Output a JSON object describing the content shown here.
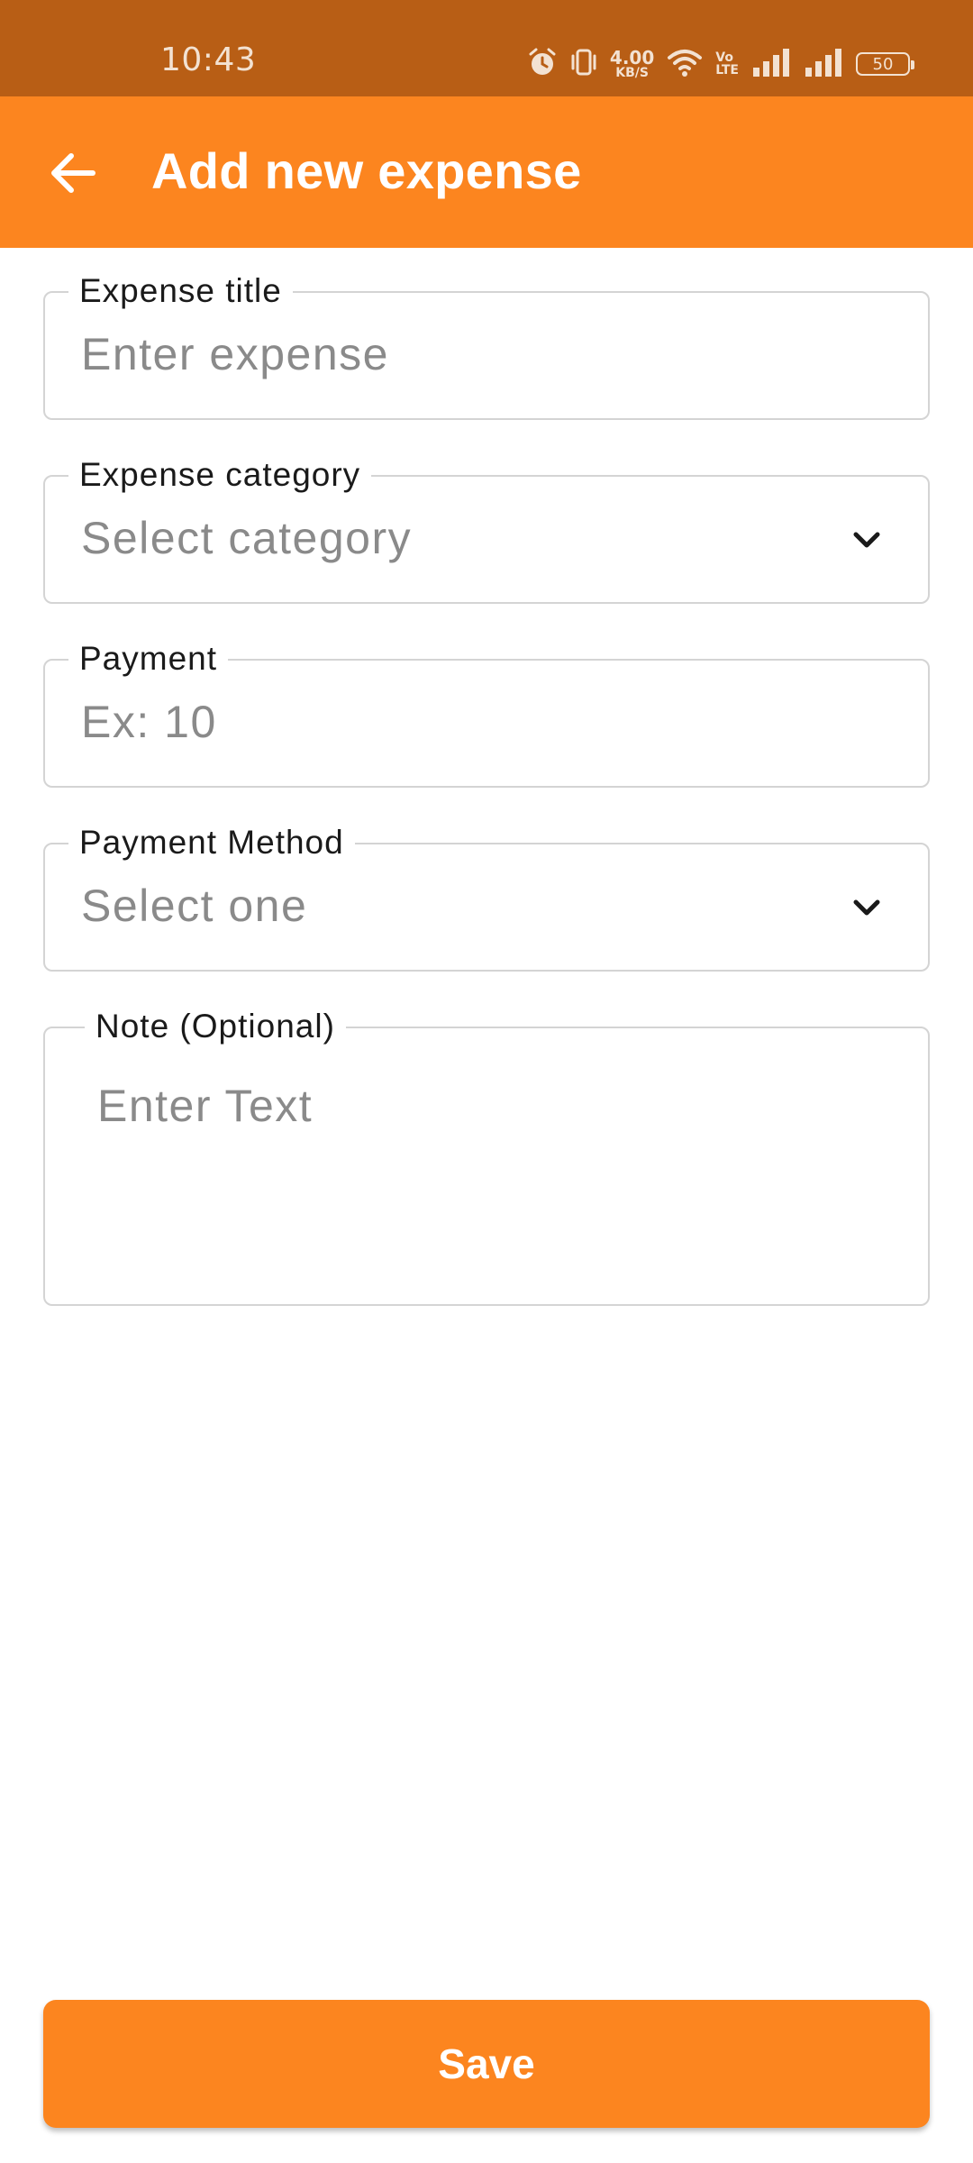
{
  "status_bar": {
    "time": "10:43",
    "net_speed_value": "4.00",
    "net_speed_unit": "KB/S",
    "volte_top": "Vo",
    "volte_bottom": "LTE",
    "battery": "50",
    "icons": [
      "alarm-icon",
      "vibrate-icon",
      "wifi-icon",
      "volte-icon",
      "signal-icon",
      "signal-icon",
      "battery-icon"
    ]
  },
  "app_bar": {
    "title": "Add new expense",
    "back_icon": "arrow-back-icon"
  },
  "form": {
    "expense_title": {
      "label": "Expense title",
      "placeholder": "Enter expense"
    },
    "expense_category": {
      "label": "Expense category",
      "placeholder": "Select category"
    },
    "payment": {
      "label": "Payment",
      "placeholder": "Ex: 10"
    },
    "payment_method": {
      "label": "Payment Method",
      "placeholder": "Select one"
    },
    "note": {
      "label": "Note (Optional)",
      "placeholder": "Enter Text"
    }
  },
  "actions": {
    "save_label": "Save"
  },
  "colors": {
    "status_bar": "#B85E15",
    "app_bar": "#FC851F",
    "accent": "#FC851F",
    "field_border": "#D4D4D4",
    "placeholder": "#8A8A8A"
  }
}
